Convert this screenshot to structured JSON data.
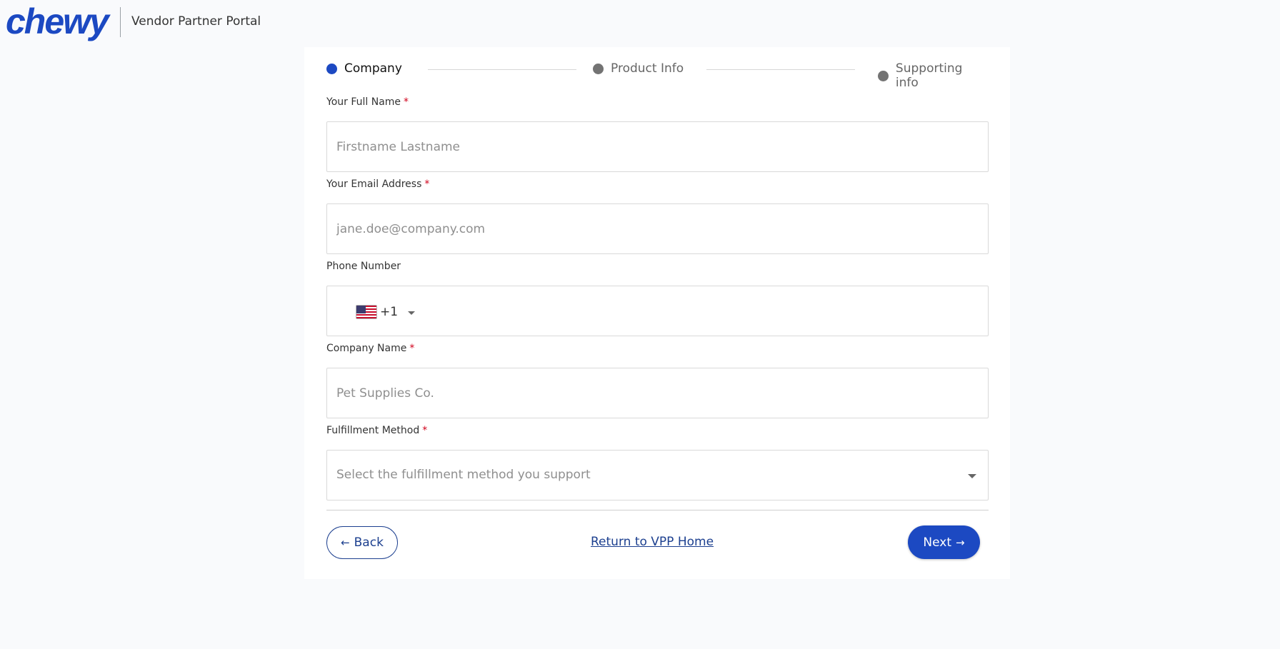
{
  "header": {
    "logo_text": "chewy",
    "portal_title": "Vendor Partner Portal"
  },
  "stepper": {
    "steps": [
      {
        "label": "Company",
        "active": true
      },
      {
        "label": "Product Info",
        "active": false
      },
      {
        "label": "Supporting info",
        "active": false
      }
    ]
  },
  "form": {
    "full_name": {
      "label": "Your Full Name",
      "required_mark": "*",
      "placeholder": "Firstname Lastname",
      "value": ""
    },
    "email": {
      "label": "Your Email Address",
      "required_mark": "*",
      "placeholder": "jane.doe@company.com",
      "value": ""
    },
    "phone": {
      "label": "Phone Number",
      "country_flag_icon": "us-flag-icon",
      "dial_code": "+1",
      "value": ""
    },
    "company_name": {
      "label": "Company Name",
      "required_mark": "*",
      "placeholder": "Pet Supplies Co.",
      "value": ""
    },
    "fulfillment": {
      "label": "Fulfillment Method",
      "required_mark": "*",
      "placeholder": "Select the fulfillment method you support"
    }
  },
  "footer": {
    "back_label": "Back",
    "back_icon": "arrow-left-icon",
    "home_link": "Return to VPP Home",
    "next_label": "Next",
    "next_icon": "arrow-right-icon"
  },
  "colors": {
    "brand": "#1c49c2",
    "required": "#d0021b",
    "inactive_step": "#737373"
  }
}
